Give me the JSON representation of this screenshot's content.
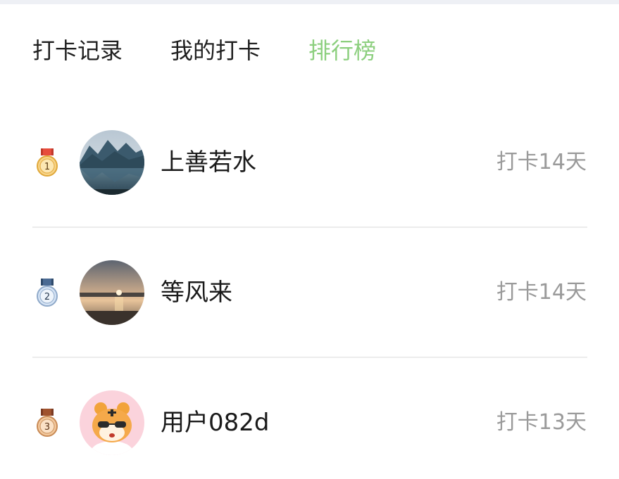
{
  "tabs": [
    {
      "label": "打卡记录",
      "active": false
    },
    {
      "label": "我的打卡",
      "active": false
    },
    {
      "label": "排行榜",
      "active": true
    }
  ],
  "colors": {
    "active_tab": "#8ccf7e",
    "text": "#1a1a1a",
    "muted": "#9a9a9a",
    "divider": "#ececec"
  },
  "leaderboard": [
    {
      "rank": "1",
      "medal": "gold-medal-icon",
      "avatar": "mountain-lake-avatar",
      "name": "上善若水",
      "days": "打卡14天"
    },
    {
      "rank": "2",
      "medal": "silver-medal-icon",
      "avatar": "sunset-lake-avatar",
      "name": "等风来",
      "days": "打卡14天"
    },
    {
      "rank": "3",
      "medal": "bronze-medal-icon",
      "avatar": "tiger-cartoon-avatar",
      "name": "用户082d",
      "days": "打卡13天"
    }
  ]
}
